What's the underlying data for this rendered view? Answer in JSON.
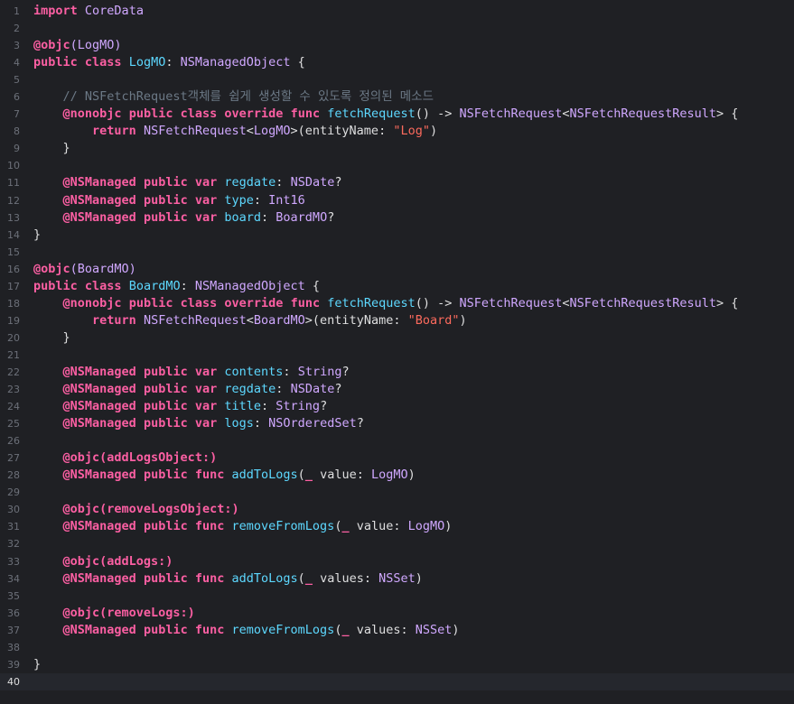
{
  "editor": {
    "language": "swift",
    "current_line": 40,
    "colors": {
      "background": "#1f2024",
      "current_line": "#25272d",
      "keyword": "#fc5fa3",
      "type": "#d0a8ff",
      "function": "#67b7a4",
      "declaration": "#5dd8ff",
      "string": "#fc6a5d",
      "comment": "#6c7986",
      "plain": "#dfdfe0",
      "line_number": "#6c7079"
    },
    "lines": [
      {
        "n": "1",
        "t": [
          [
            "kw",
            "import"
          ],
          [
            "pl",
            " "
          ],
          [
            "tp",
            "CoreData"
          ]
        ]
      },
      {
        "n": "2",
        "t": []
      },
      {
        "n": "3",
        "t": [
          [
            "kw",
            "@objc"
          ],
          [
            "tp",
            "(LogMO)"
          ]
        ]
      },
      {
        "n": "4",
        "t": [
          [
            "kw",
            "public"
          ],
          [
            "pl",
            " "
          ],
          [
            "kw",
            "class"
          ],
          [
            "pl",
            " "
          ],
          [
            "dc",
            "LogMO"
          ],
          [
            "pl",
            ": "
          ],
          [
            "tp",
            "NSManagedObject"
          ],
          [
            "pl",
            " {"
          ]
        ]
      },
      {
        "n": "5",
        "t": []
      },
      {
        "n": "6",
        "t": [
          [
            "pl",
            "    "
          ],
          [
            "cm",
            "// NSFetchRequest객체를 쉽게 생성할 수 있도록 정의된 메소드"
          ]
        ]
      },
      {
        "n": "7",
        "t": [
          [
            "pl",
            "    "
          ],
          [
            "kw",
            "@nonobjc"
          ],
          [
            "pl",
            " "
          ],
          [
            "kw",
            "public"
          ],
          [
            "pl",
            " "
          ],
          [
            "kw",
            "class"
          ],
          [
            "pl",
            " "
          ],
          [
            "kw",
            "override"
          ],
          [
            "pl",
            " "
          ],
          [
            "kw",
            "func"
          ],
          [
            "pl",
            " "
          ],
          [
            "dc",
            "fetchRequest"
          ],
          [
            "pl",
            "() -> "
          ],
          [
            "tp",
            "NSFetchRequest"
          ],
          [
            "pl",
            "<"
          ],
          [
            "tp",
            "NSFetchRequestResult"
          ],
          [
            "pl",
            "> {"
          ]
        ]
      },
      {
        "n": "8",
        "t": [
          [
            "pl",
            "        "
          ],
          [
            "kw",
            "return"
          ],
          [
            "pl",
            " "
          ],
          [
            "tp",
            "NSFetchRequest"
          ],
          [
            "pl",
            "<"
          ],
          [
            "tp",
            "LogMO"
          ],
          [
            "pl",
            ">(entityName: "
          ],
          [
            "str",
            "\"Log\""
          ],
          [
            "pl",
            ")"
          ]
        ]
      },
      {
        "n": "9",
        "t": [
          [
            "pl",
            "    }"
          ]
        ]
      },
      {
        "n": "10",
        "t": []
      },
      {
        "n": "11",
        "t": [
          [
            "pl",
            "    "
          ],
          [
            "kw",
            "@NSManaged"
          ],
          [
            "pl",
            " "
          ],
          [
            "kw",
            "public"
          ],
          [
            "pl",
            " "
          ],
          [
            "kw",
            "var"
          ],
          [
            "pl",
            " "
          ],
          [
            "dc",
            "regdate"
          ],
          [
            "pl",
            ": "
          ],
          [
            "tp",
            "NSDate"
          ],
          [
            "pl",
            "?"
          ]
        ]
      },
      {
        "n": "12",
        "t": [
          [
            "pl",
            "    "
          ],
          [
            "kw",
            "@NSManaged"
          ],
          [
            "pl",
            " "
          ],
          [
            "kw",
            "public"
          ],
          [
            "pl",
            " "
          ],
          [
            "kw",
            "var"
          ],
          [
            "pl",
            " "
          ],
          [
            "dc",
            "type"
          ],
          [
            "pl",
            ": "
          ],
          [
            "tp",
            "Int16"
          ]
        ]
      },
      {
        "n": "13",
        "t": [
          [
            "pl",
            "    "
          ],
          [
            "kw",
            "@NSManaged"
          ],
          [
            "pl",
            " "
          ],
          [
            "kw",
            "public"
          ],
          [
            "pl",
            " "
          ],
          [
            "kw",
            "var"
          ],
          [
            "pl",
            " "
          ],
          [
            "dc",
            "board"
          ],
          [
            "pl",
            ": "
          ],
          [
            "tp",
            "BoardMO"
          ],
          [
            "pl",
            "?"
          ]
        ]
      },
      {
        "n": "14",
        "t": [
          [
            "pl",
            "}"
          ]
        ]
      },
      {
        "n": "15",
        "t": []
      },
      {
        "n": "16",
        "t": [
          [
            "kw",
            "@objc"
          ],
          [
            "tp",
            "(BoardMO)"
          ]
        ]
      },
      {
        "n": "17",
        "t": [
          [
            "kw",
            "public"
          ],
          [
            "pl",
            " "
          ],
          [
            "kw",
            "class"
          ],
          [
            "pl",
            " "
          ],
          [
            "dc",
            "BoardMO"
          ],
          [
            "pl",
            ": "
          ],
          [
            "tp",
            "NSManagedObject"
          ],
          [
            "pl",
            " {"
          ]
        ]
      },
      {
        "n": "18",
        "t": [
          [
            "pl",
            "    "
          ],
          [
            "kw",
            "@nonobjc"
          ],
          [
            "pl",
            " "
          ],
          [
            "kw",
            "public"
          ],
          [
            "pl",
            " "
          ],
          [
            "kw",
            "class"
          ],
          [
            "pl",
            " "
          ],
          [
            "kw",
            "override"
          ],
          [
            "pl",
            " "
          ],
          [
            "kw",
            "func"
          ],
          [
            "pl",
            " "
          ],
          [
            "dc",
            "fetchRequest"
          ],
          [
            "pl",
            "() -> "
          ],
          [
            "tp",
            "NSFetchRequest"
          ],
          [
            "pl",
            "<"
          ],
          [
            "tp",
            "NSFetchRequestResult"
          ],
          [
            "pl",
            "> {"
          ]
        ]
      },
      {
        "n": "19",
        "t": [
          [
            "pl",
            "        "
          ],
          [
            "kw",
            "return"
          ],
          [
            "pl",
            " "
          ],
          [
            "tp",
            "NSFetchRequest"
          ],
          [
            "pl",
            "<"
          ],
          [
            "tp",
            "BoardMO"
          ],
          [
            "pl",
            ">(entityName: "
          ],
          [
            "str",
            "\"Board\""
          ],
          [
            "pl",
            ")"
          ]
        ]
      },
      {
        "n": "20",
        "t": [
          [
            "pl",
            "    }"
          ]
        ]
      },
      {
        "n": "21",
        "t": []
      },
      {
        "n": "22",
        "t": [
          [
            "pl",
            "    "
          ],
          [
            "kw",
            "@NSManaged"
          ],
          [
            "pl",
            " "
          ],
          [
            "kw",
            "public"
          ],
          [
            "pl",
            " "
          ],
          [
            "kw",
            "var"
          ],
          [
            "pl",
            " "
          ],
          [
            "dc",
            "contents"
          ],
          [
            "pl",
            ": "
          ],
          [
            "tp",
            "String"
          ],
          [
            "pl",
            "?"
          ]
        ]
      },
      {
        "n": "23",
        "t": [
          [
            "pl",
            "    "
          ],
          [
            "kw",
            "@NSManaged"
          ],
          [
            "pl",
            " "
          ],
          [
            "kw",
            "public"
          ],
          [
            "pl",
            " "
          ],
          [
            "kw",
            "var"
          ],
          [
            "pl",
            " "
          ],
          [
            "dc",
            "regdate"
          ],
          [
            "pl",
            ": "
          ],
          [
            "tp",
            "NSDate"
          ],
          [
            "pl",
            "?"
          ]
        ]
      },
      {
        "n": "24",
        "t": [
          [
            "pl",
            "    "
          ],
          [
            "kw",
            "@NSManaged"
          ],
          [
            "pl",
            " "
          ],
          [
            "kw",
            "public"
          ],
          [
            "pl",
            " "
          ],
          [
            "kw",
            "var"
          ],
          [
            "pl",
            " "
          ],
          [
            "dc",
            "title"
          ],
          [
            "pl",
            ": "
          ],
          [
            "tp",
            "String"
          ],
          [
            "pl",
            "?"
          ]
        ]
      },
      {
        "n": "25",
        "t": [
          [
            "pl",
            "    "
          ],
          [
            "kw",
            "@NSManaged"
          ],
          [
            "pl",
            " "
          ],
          [
            "kw",
            "public"
          ],
          [
            "pl",
            " "
          ],
          [
            "kw",
            "var"
          ],
          [
            "pl",
            " "
          ],
          [
            "dc",
            "logs"
          ],
          [
            "pl",
            ": "
          ],
          [
            "tp",
            "NSOrderedSet"
          ],
          [
            "pl",
            "?"
          ]
        ]
      },
      {
        "n": "26",
        "t": []
      },
      {
        "n": "27",
        "t": [
          [
            "pl",
            "    "
          ],
          [
            "kw",
            "@objc(addLogsObject:)"
          ]
        ]
      },
      {
        "n": "28",
        "t": [
          [
            "pl",
            "    "
          ],
          [
            "kw",
            "@NSManaged"
          ],
          [
            "pl",
            " "
          ],
          [
            "kw",
            "public"
          ],
          [
            "pl",
            " "
          ],
          [
            "kw",
            "func"
          ],
          [
            "pl",
            " "
          ],
          [
            "dc",
            "addToLogs"
          ],
          [
            "pl",
            "("
          ],
          [
            "kw",
            "_"
          ],
          [
            "pl",
            " value: "
          ],
          [
            "tp",
            "LogMO"
          ],
          [
            "pl",
            ")"
          ]
        ]
      },
      {
        "n": "29",
        "t": []
      },
      {
        "n": "30",
        "t": [
          [
            "pl",
            "    "
          ],
          [
            "kw",
            "@objc(removeLogsObject:)"
          ]
        ]
      },
      {
        "n": "31",
        "t": [
          [
            "pl",
            "    "
          ],
          [
            "kw",
            "@NSManaged"
          ],
          [
            "pl",
            " "
          ],
          [
            "kw",
            "public"
          ],
          [
            "pl",
            " "
          ],
          [
            "kw",
            "func"
          ],
          [
            "pl",
            " "
          ],
          [
            "dc",
            "removeFromLogs"
          ],
          [
            "pl",
            "("
          ],
          [
            "kw",
            "_"
          ],
          [
            "pl",
            " value: "
          ],
          [
            "tp",
            "LogMO"
          ],
          [
            "pl",
            ")"
          ]
        ]
      },
      {
        "n": "32",
        "t": []
      },
      {
        "n": "33",
        "t": [
          [
            "pl",
            "    "
          ],
          [
            "kw",
            "@objc(addLogs:)"
          ]
        ]
      },
      {
        "n": "34",
        "t": [
          [
            "pl",
            "    "
          ],
          [
            "kw",
            "@NSManaged"
          ],
          [
            "pl",
            " "
          ],
          [
            "kw",
            "public"
          ],
          [
            "pl",
            " "
          ],
          [
            "kw",
            "func"
          ],
          [
            "pl",
            " "
          ],
          [
            "dc",
            "addToLogs"
          ],
          [
            "pl",
            "("
          ],
          [
            "kw",
            "_"
          ],
          [
            "pl",
            " values: "
          ],
          [
            "tp",
            "NSSet"
          ],
          [
            "pl",
            ")"
          ]
        ]
      },
      {
        "n": "35",
        "t": []
      },
      {
        "n": "36",
        "t": [
          [
            "pl",
            "    "
          ],
          [
            "kw",
            "@objc(removeLogs:)"
          ]
        ]
      },
      {
        "n": "37",
        "t": [
          [
            "pl",
            "    "
          ],
          [
            "kw",
            "@NSManaged"
          ],
          [
            "pl",
            " "
          ],
          [
            "kw",
            "public"
          ],
          [
            "pl",
            " "
          ],
          [
            "kw",
            "func"
          ],
          [
            "pl",
            " "
          ],
          [
            "dc",
            "removeFromLogs"
          ],
          [
            "pl",
            "("
          ],
          [
            "kw",
            "_"
          ],
          [
            "pl",
            " values: "
          ],
          [
            "tp",
            "NSSet"
          ],
          [
            "pl",
            ")"
          ]
        ]
      },
      {
        "n": "38",
        "t": []
      },
      {
        "n": "39",
        "t": [
          [
            "pl",
            "}"
          ]
        ]
      },
      {
        "n": "40",
        "t": []
      }
    ]
  }
}
